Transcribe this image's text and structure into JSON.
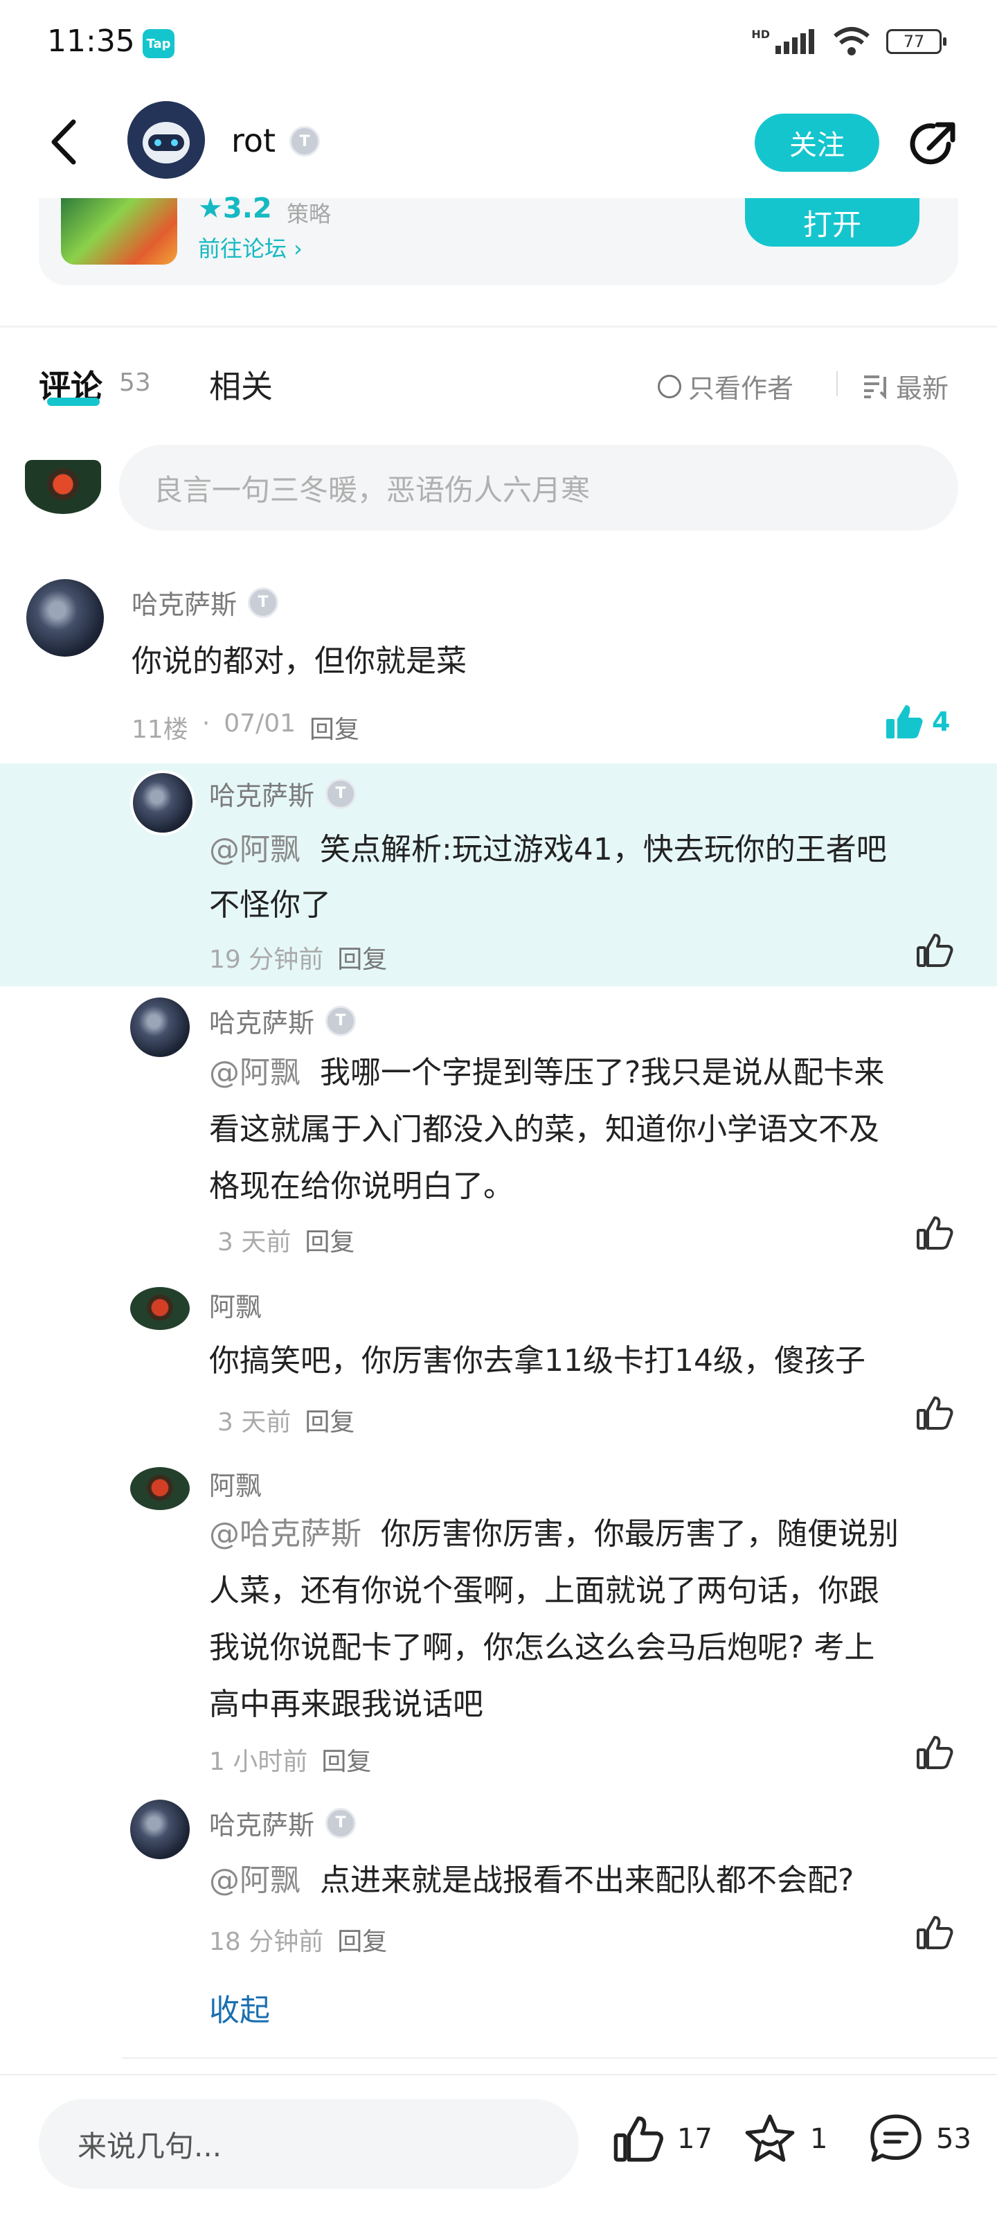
{
  "status_bar": {
    "time": "11:35",
    "app_badge": "Tap",
    "network": "HD",
    "battery": "77"
  },
  "header": {
    "back_icon": "chevron-left-icon",
    "name": "rot",
    "level": "T",
    "follow_label": "关注",
    "share_icon": "share-icon"
  },
  "game_card": {
    "rating": "★3.2",
    "tag": "策略",
    "forum_link": "前往论坛 ›",
    "open_label": "打开"
  },
  "tabs": {
    "comments_label": "评论",
    "comments_count": "53",
    "related_label": "相关",
    "author_only": "只看作者",
    "sort": "最新"
  },
  "comment_input": {
    "placeholder": "良言一句三冬暖，恶语伤人六月寒"
  },
  "main_comment": {
    "user": "哈克萨斯",
    "level": "T",
    "text": "你说的都对，但你就是菜",
    "floor": "11楼",
    "date": "07/01",
    "reply": "回复",
    "likes": "4"
  },
  "replies": [
    {
      "user": "哈克萨斯",
      "level": "T",
      "mention": "@阿飘",
      "line1": "笑点解析:玩过游戏41，快去玩你的王者吧",
      "line2": "不怪你了",
      "line3": "",
      "line4": "",
      "time": "19 分钟前",
      "reply": "回复"
    },
    {
      "user": "哈克萨斯",
      "level": "T",
      "mention": "@阿飘",
      "line1": "我哪一个字提到等压了?我只是说从配卡来",
      "line2": "看这就属于入门都没入的菜，知道你小学语文不及",
      "line3": "格现在给你说明白了。",
      "line4": "",
      "time": "3 天前",
      "reply": "回复"
    },
    {
      "user": "阿飘",
      "level": "",
      "mention": "",
      "line1": "你搞笑吧，你厉害你去拿11级卡打14级，傻孩子",
      "line2": "",
      "line3": "",
      "line4": "",
      "time": "3 天前",
      "reply": "回复"
    },
    {
      "user": "阿飘",
      "level": "",
      "mention": "@哈克萨斯",
      "line1": "你厉害你厉害，你最厉害了，随便说别",
      "line2": "人菜，还有你说个蛋啊，上面就说了两句话，你跟",
      "line3": "我说你说配卡了啊，你怎么这么会马后炮呢? 考上",
      "line4": "高中再来跟我说话吧",
      "time": "1 小时前",
      "reply": "回复"
    },
    {
      "user": "哈克萨斯",
      "level": "T",
      "mention": "@阿飘",
      "line1": "点进来就是战报看不出来配队都不会配?",
      "line2": "",
      "line3": "",
      "line4": "",
      "time": "18 分钟前",
      "reply": "回复"
    }
  ],
  "collapse_label": "收起",
  "bottom_bar": {
    "placeholder": "来说几句...",
    "likes": "17",
    "favorites": "1",
    "comments": "53"
  },
  "colors": {
    "accent": "#15c5ce",
    "highlight": "#e6f7f7",
    "link": "#1b6fb0"
  }
}
